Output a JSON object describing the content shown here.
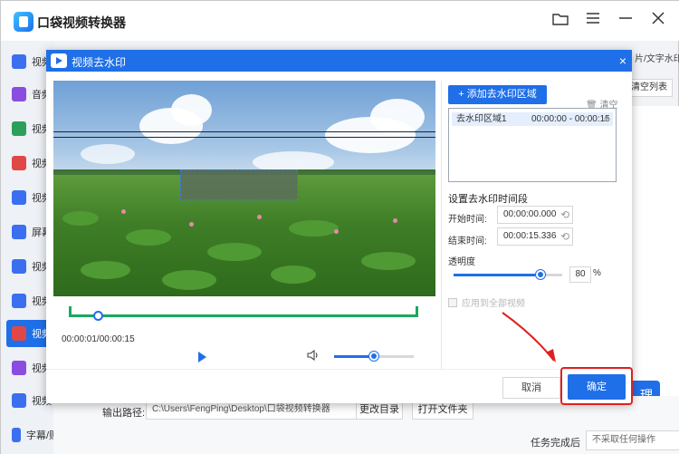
{
  "app": {
    "title": "口袋视频转换器",
    "window_icons": [
      "folder-icon",
      "menu-icon",
      "minimize-icon",
      "close-icon"
    ]
  },
  "sidebar": {
    "items": [
      {
        "label": "视频",
        "color": "#3b6ff0"
      },
      {
        "label": "音频",
        "color": "#8a4de0"
      },
      {
        "label": "视频",
        "color": "#2ca05a"
      },
      {
        "label": "视频",
        "color": "#e04848"
      },
      {
        "label": "视频",
        "color": "#3b6ff0"
      },
      {
        "label": "屏幕",
        "color": "#3b6ff0"
      },
      {
        "label": "视频",
        "color": "#3b6ff0"
      },
      {
        "label": "视频",
        "color": "#3b6ff0"
      },
      {
        "label": "视频",
        "color": "#e04848",
        "active": true
      },
      {
        "label": "视频",
        "color": "#8a4de0"
      },
      {
        "label": "视频",
        "color": "#3b6ff0"
      },
      {
        "label": "字幕/贴图",
        "color": "#3b6ff0"
      }
    ]
  },
  "right_panel": {
    "top_text": "片/文字水印",
    "clear_list": "清空列表",
    "big_button": "理"
  },
  "bottom": {
    "output_label": "输出路径:",
    "output_path": "C:\\Users\\FengPing\\Desktop\\口袋视频转换器",
    "change_dir": "更改目录",
    "open_folder": "打开文件夹",
    "task_label": "任务完成后",
    "task_value": "不采取任何操作"
  },
  "modal": {
    "title": "视频去水印",
    "close": "×",
    "time_display": "00:00:01/00:00:15",
    "playback_progress": 0.07,
    "volume": 0.5,
    "add_region": "+ 添加去水印区域",
    "clear": "清空",
    "regions": [
      {
        "name": "去水印区域1",
        "time": "00:00:00 - 00:00:15"
      }
    ],
    "section_title": "设置去水印时间段",
    "start_label": "开始时间:",
    "start_value": "00:00:00.000",
    "end_label": "结束时间:",
    "end_value": "00:00:15.336",
    "opacity_label": "透明度",
    "opacity_value": "80",
    "opacity_unit": "%",
    "apply_all": "应用到全部视频",
    "cancel": "取消",
    "ok": "确定"
  },
  "colors": {
    "accent": "#1f6fe8",
    "timeline": "#19a95f",
    "highlight": "#e02020"
  }
}
